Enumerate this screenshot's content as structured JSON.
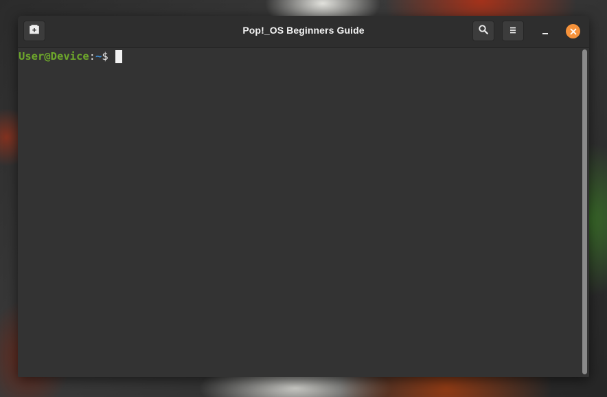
{
  "window": {
    "title": "Pop!_OS Beginners Guide"
  },
  "headerbar": {
    "new_tab_icon": "new-tab-icon",
    "search_icon": "search-icon",
    "menu_icon": "hamburger-menu-icon",
    "minimize_icon": "minimize-icon",
    "close_icon": "close-icon"
  },
  "terminal": {
    "prompt": {
      "user_host": "User@Device",
      "separator": ":",
      "cwd": "~",
      "symbol": "$ "
    }
  },
  "colors": {
    "user_host": "#6ea82b",
    "cwd": "#3f8fd6",
    "close_button": "#f6923a",
    "terminal_bg": "#333333",
    "headerbar_bg": "#2e2e2e"
  }
}
